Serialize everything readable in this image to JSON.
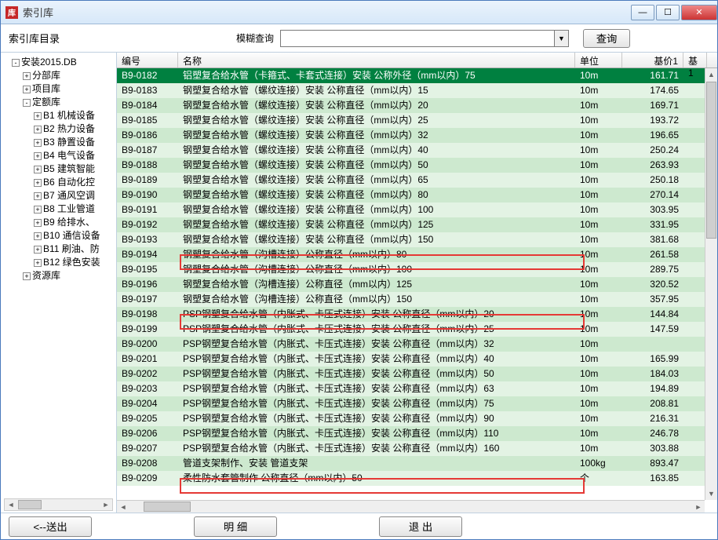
{
  "window": {
    "title": "索引库"
  },
  "searchbar": {
    "catalog_label": "索引库目录",
    "search_label": "模糊查询",
    "search_value": "",
    "search_button": "查询"
  },
  "tree": {
    "root": "安装2015.DB",
    "nodes": [
      {
        "label": "分部库",
        "expand": "+"
      },
      {
        "label": "项目库",
        "expand": "+"
      },
      {
        "label": "定额库",
        "expand": "-",
        "children": [
          {
            "label": "B1 机械设备",
            "expand": "+"
          },
          {
            "label": "B2 热力设备",
            "expand": "+"
          },
          {
            "label": "B3 静置设备",
            "expand": "+"
          },
          {
            "label": "B4 电气设备",
            "expand": "+"
          },
          {
            "label": "B5 建筑智能",
            "expand": "+"
          },
          {
            "label": "B6 自动化控",
            "expand": "+"
          },
          {
            "label": "B7 通风空调",
            "expand": "+"
          },
          {
            "label": "B8 工业管道",
            "expand": "+"
          },
          {
            "label": "B9 给排水、",
            "expand": "+"
          },
          {
            "label": "B10 通信设备",
            "expand": "+"
          },
          {
            "label": "B11 刷油、防",
            "expand": "+"
          },
          {
            "label": "B12 绿色安装",
            "expand": "+"
          }
        ]
      },
      {
        "label": "资源库",
        "expand": "+"
      }
    ]
  },
  "grid": {
    "headers": {
      "id": "编号",
      "name": "名称",
      "unit": "单位",
      "price1": "基价1",
      "last": "基1"
    },
    "rows": [
      {
        "id": "B9-0182",
        "name": "铝塑复合给水管（卡箍式、卡套式连接）安装 公称外径（mm以内）75",
        "unit": "10m",
        "price": "161.71",
        "sel": true
      },
      {
        "id": "B9-0183",
        "name": "钢塑复合给水管（螺纹连接）安装 公称直径（mm以内）15",
        "unit": "10m",
        "price": "174.65"
      },
      {
        "id": "B9-0184",
        "name": "钢塑复合给水管（螺纹连接）安装 公称直径（mm以内）20",
        "unit": "10m",
        "price": "169.71"
      },
      {
        "id": "B9-0185",
        "name": "钢塑复合给水管（螺纹连接）安装 公称直径（mm以内）25",
        "unit": "10m",
        "price": "193.72"
      },
      {
        "id": "B9-0186",
        "name": "钢塑复合给水管（螺纹连接）安装 公称直径（mm以内）32",
        "unit": "10m",
        "price": "196.65"
      },
      {
        "id": "B9-0187",
        "name": "钢塑复合给水管（螺纹连接）安装 公称直径（mm以内）40",
        "unit": "10m",
        "price": "250.24"
      },
      {
        "id": "B9-0188",
        "name": "钢塑复合给水管（螺纹连接）安装 公称直径（mm以内）50",
        "unit": "10m",
        "price": "263.93"
      },
      {
        "id": "B9-0189",
        "name": "钢塑复合给水管（螺纹连接）安装 公称直径（mm以内）65",
        "unit": "10m",
        "price": "250.18"
      },
      {
        "id": "B9-0190",
        "name": "钢塑复合给水管（螺纹连接）安装 公称直径（mm以内）80",
        "unit": "10m",
        "price": "270.14"
      },
      {
        "id": "B9-0191",
        "name": "钢塑复合给水管（螺纹连接）安装 公称直径（mm以内）100",
        "unit": "10m",
        "price": "303.95"
      },
      {
        "id": "B9-0192",
        "name": "钢塑复合给水管（螺纹连接）安装 公称直径（mm以内）125",
        "unit": "10m",
        "price": "331.95"
      },
      {
        "id": "B9-0193",
        "name": "钢塑复合给水管（螺纹连接）安装 公称直径（mm以内）150",
        "unit": "10m",
        "price": "381.68"
      },
      {
        "id": "B9-0194",
        "name": "钢塑复合给水管（沟槽连接）公称直径（mm以内）80",
        "unit": "10m",
        "price": "261.58"
      },
      {
        "id": "B9-0195",
        "name": "钢塑复合给水管（沟槽连接）公称直径（mm以内）100",
        "unit": "10m",
        "price": "289.75"
      },
      {
        "id": "B9-0196",
        "name": "钢塑复合给水管（沟槽连接）公称直径（mm以内）125",
        "unit": "10m",
        "price": "320.52"
      },
      {
        "id": "B9-0197",
        "name": "钢塑复合给水管（沟槽连接）公称直径（mm以内）150",
        "unit": "10m",
        "price": "357.95"
      },
      {
        "id": "B9-0198",
        "name": "PSP钢塑复合给水管（内胀式、卡压式连接）安装 公称直径（mm以内）20",
        "unit": "10m",
        "price": "144.84"
      },
      {
        "id": "B9-0199",
        "name": "PSP钢塑复合给水管（内胀式、卡压式连接）安装 公称直径（mm以内）25",
        "unit": "10m",
        "price": "147.59"
      },
      {
        "id": "B9-0200",
        "name": "PSP钢塑复合给水管（内胀式、卡压式连接）安装 公称直径（mm以内）32",
        "unit": "10m",
        "price": ""
      },
      {
        "id": "B9-0201",
        "name": "PSP钢塑复合给水管（内胀式、卡压式连接）安装 公称直径（mm以内）40",
        "unit": "10m",
        "price": "165.99"
      },
      {
        "id": "B9-0202",
        "name": "PSP钢塑复合给水管（内胀式、卡压式连接）安装 公称直径（mm以内）50",
        "unit": "10m",
        "price": "184.03"
      },
      {
        "id": "B9-0203",
        "name": "PSP钢塑复合给水管（内胀式、卡压式连接）安装 公称直径（mm以内）63",
        "unit": "10m",
        "price": "194.89"
      },
      {
        "id": "B9-0204",
        "name": "PSP钢塑复合给水管（内胀式、卡压式连接）安装 公称直径（mm以内）75",
        "unit": "10m",
        "price": "208.81"
      },
      {
        "id": "B9-0205",
        "name": "PSP钢塑复合给水管（内胀式、卡压式连接）安装 公称直径（mm以内）90",
        "unit": "10m",
        "price": "216.31"
      },
      {
        "id": "B9-0206",
        "name": "PSP钢塑复合给水管（内胀式、卡压式连接）安装 公称直径（mm以内）110",
        "unit": "10m",
        "price": "246.78"
      },
      {
        "id": "B9-0207",
        "name": "PSP钢塑复合给水管（内胀式、卡压式连接）安装 公称直径（mm以内）160",
        "unit": "10m",
        "price": "303.88"
      },
      {
        "id": "B9-0208",
        "name": "管道支架制作、安装 管道支架",
        "unit": "100kg",
        "price": "893.47"
      },
      {
        "id": "B9-0209",
        "name": "柔性防水套管制作 公称直径（mm以内）50",
        "unit": "个",
        "price": "163.85"
      }
    ]
  },
  "footer": {
    "send": "<--送出",
    "detail": "明 细",
    "exit": "退 出"
  }
}
